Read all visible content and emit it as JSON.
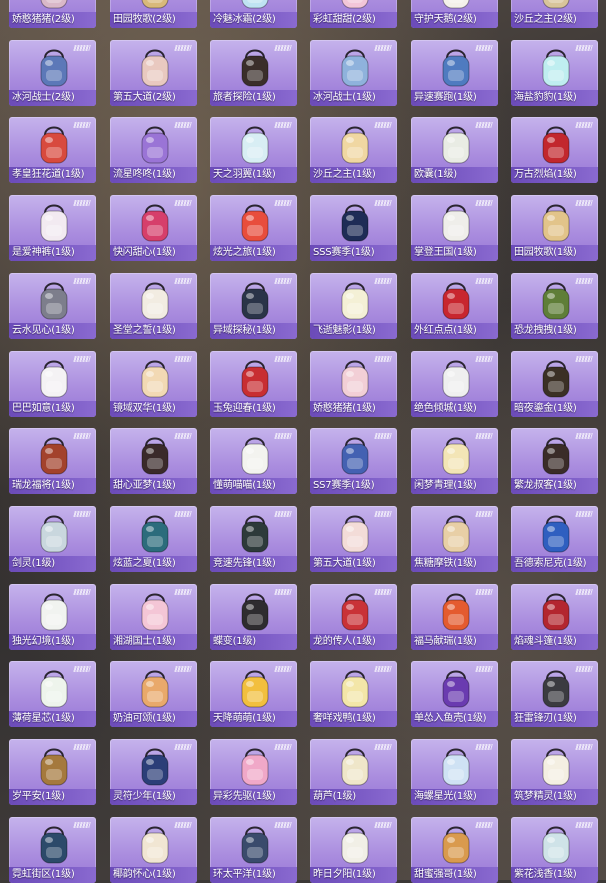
{
  "colors": {
    "card_top": "#c5b3ec",
    "card_bottom": "#9777d6",
    "label_bar": "#6b4bb8"
  },
  "items": [
    {
      "label": "娇憨猪猪(2级)",
      "icon": "pig-backpack-icon",
      "color": "#d9b8c8"
    },
    {
      "label": "田园牧歌(2级)",
      "icon": "basket-backpack-icon",
      "color": "#d8b97a"
    },
    {
      "label": "冷魅冰霜(2级)",
      "icon": "ice-backpack-icon",
      "color": "#bfe3f2"
    },
    {
      "label": "彩虹甜甜(2级)",
      "icon": "rainbow-backpack-icon",
      "color": "#f2c6d8"
    },
    {
      "label": "守护天鹅(2级)",
      "icon": "swan-backpack-icon",
      "color": "#f4f1ea"
    },
    {
      "label": "沙丘之主(2级)",
      "icon": "dune-backpack-icon",
      "color": "#d8c49a"
    },
    {
      "label": "冰河战士(2级)",
      "icon": "glacier-backpack-icon",
      "color": "#5c78b8"
    },
    {
      "label": "第五大道(2级)",
      "icon": "fifth-avenue-backpack-icon",
      "color": "#e9c9c0"
    },
    {
      "label": "旅者探险(1级)",
      "icon": "explorer-backpack-icon",
      "color": "#3a2e2a"
    },
    {
      "label": "冰河战士(1级)",
      "icon": "glacier-backpack-icon",
      "color": "#8fb2dc"
    },
    {
      "label": "异速赛跑(1级)",
      "icon": "racer-backpack-icon",
      "color": "#4f7bc0"
    },
    {
      "label": "海盐豹豹(1级)",
      "icon": "leopard-backpack-icon",
      "color": "#bfeef0"
    },
    {
      "label": "孝皇狂花道(1级)",
      "icon": "flower-backpack-icon",
      "color": "#d84a3e"
    },
    {
      "label": "流星咚咚(1级)",
      "icon": "meteor-backpack-icon",
      "color": "#9a74d6"
    },
    {
      "label": "天之羽翼(1级)",
      "icon": "wing-backpack-icon",
      "color": "#d8eef4"
    },
    {
      "label": "沙丘之主(1级)",
      "icon": "dune-backpack-icon",
      "color": "#f0d7a2"
    },
    {
      "label": "欧囊(1级)",
      "icon": "pouch-backpack-icon",
      "color": "#e9ece4"
    },
    {
      "label": "万古烈焰(1级)",
      "icon": "flame-backpack-icon",
      "color": "#c2272e"
    },
    {
      "label": "是爱神裤(1级)",
      "icon": "bunny-backpack-icon",
      "color": "#f2eaf1"
    },
    {
      "label": "快闪甜心(1级)",
      "icon": "camera-backpack-icon",
      "color": "#d63f6b"
    },
    {
      "label": "炫光之旅(1级)",
      "icon": "trip-backpack-icon",
      "color": "#e84d3c"
    },
    {
      "label": "SSS赛季(1级)",
      "icon": "season-backpack-icon",
      "color": "#1e2c56"
    },
    {
      "label": "掌登王国(1级)",
      "icon": "panda-backpack-icon",
      "color": "#efeeea"
    },
    {
      "label": "田园牧歌(1级)",
      "icon": "basket-backpack-icon",
      "color": "#e2c48a"
    },
    {
      "label": "云水见心(1级)",
      "icon": "cloud-backpack-icon",
      "color": "#7d7e8c"
    },
    {
      "label": "圣堂之誓(1级)",
      "icon": "heart-backpack-icon",
      "color": "#f2ece2"
    },
    {
      "label": "异域探秘(1级)",
      "icon": "mystery-backpack-icon",
      "color": "#2a3448"
    },
    {
      "label": "飞逝魅影(1级)",
      "icon": "phantom-backpack-icon",
      "color": "#f4f0d6"
    },
    {
      "label": "外红点点(1级)",
      "icon": "dot-backpack-icon",
      "color": "#c8262f"
    },
    {
      "label": "恐龙拽拽(1级)",
      "icon": "dino-backpack-icon",
      "color": "#5f7e38"
    },
    {
      "label": "巴巴如意(1级)",
      "icon": "rabbit-backpack-icon",
      "color": "#f4f2f4"
    },
    {
      "label": "镜域双华(1级)",
      "icon": "mirror-backpack-icon",
      "color": "#f2d9b4"
    },
    {
      "label": "玉兔迎春(1级)",
      "icon": "jade-rabbit-backpack-icon",
      "color": "#c82e32"
    },
    {
      "label": "娇憨猪猪(1级)",
      "icon": "pig-backpack-icon",
      "color": "#f2cfd6"
    },
    {
      "label": "绝色倾城(1级)",
      "icon": "beauty-backpack-icon",
      "color": "#efefef"
    },
    {
      "label": "暗夜鎏金(1级)",
      "icon": "gold-backpack-icon",
      "color": "#3b3025"
    },
    {
      "label": "瑞龙福将(1级)",
      "icon": "dragon-backpack-icon",
      "color": "#a3422c"
    },
    {
      "label": "甜心亚梦(1级)",
      "icon": "sweetheart-backpack-icon",
      "color": "#3a2a2a"
    },
    {
      "label": "懂萌喵喵(1级)",
      "icon": "kitty-backpack-icon",
      "color": "#f3f3ef"
    },
    {
      "label": "SS7赛季(1级)",
      "icon": "season-backpack-icon",
      "color": "#4461b2"
    },
    {
      "label": "闲梦青理(1级)",
      "icon": "dream-backpack-icon",
      "color": "#f3e5b6"
    },
    {
      "label": "繁龙叔客(1级)",
      "icon": "traveler-backpack-icon",
      "color": "#3a2c28"
    },
    {
      "label": "剑灵(1级)",
      "icon": "sword-backpack-icon",
      "color": "#c9d7de"
    },
    {
      "label": "炫蓝之夏(1级)",
      "icon": "summer-backpack-icon",
      "color": "#2c6c7c"
    },
    {
      "label": "竞速先锋(1级)",
      "icon": "speed-backpack-icon",
      "color": "#2d3a3a"
    },
    {
      "label": "第五大道(1级)",
      "icon": "fifth-avenue-backpack-icon",
      "color": "#f3dcd8"
    },
    {
      "label": "焦糖摩铁(1级)",
      "icon": "caramel-backpack-icon",
      "color": "#e8cfa6"
    },
    {
      "label": "吾德索尼克(1级)",
      "icon": "sonic-backpack-icon",
      "color": "#2f5fc0"
    },
    {
      "label": "独光幻境(1级)",
      "icon": "illusion-backpack-icon",
      "color": "#f1f3f0"
    },
    {
      "label": "湘湖国士(1级)",
      "icon": "guardian-backpack-icon",
      "color": "#f4c6d6"
    },
    {
      "label": "蝶变(1级)",
      "icon": "butterfly-backpack-icon",
      "color": "#2e2c2f"
    },
    {
      "label": "龙的传人(1级)",
      "icon": "dragon-heir-backpack-icon",
      "color": "#c93237"
    },
    {
      "label": "福马献瑞(1级)",
      "icon": "horse-backpack-icon",
      "color": "#e45b2f"
    },
    {
      "label": "焰魂斗篷(1级)",
      "icon": "cape-backpack-icon",
      "color": "#b3262f"
    },
    {
      "label": "薄荷星芯(1级)",
      "icon": "mint-backpack-icon",
      "color": "#eef4ec"
    },
    {
      "label": "奶油可颂(1级)",
      "icon": "croissant-backpack-icon",
      "color": "#e9a96b"
    },
    {
      "label": "天降萌萌(1级)",
      "icon": "cute-backpack-icon",
      "color": "#f2bf3e"
    },
    {
      "label": "奢咩戏鸭(1级)",
      "icon": "duck-backpack-icon",
      "color": "#f3e6a8"
    },
    {
      "label": "单怂入鱼壳(1级)",
      "icon": "shell-backpack-icon",
      "color": "#6a3bb0"
    },
    {
      "label": "狂雷锋刃(1级)",
      "icon": "blade-backpack-icon",
      "color": "#3b3b40"
    },
    {
      "label": "岁平安(1级)",
      "icon": "peace-basket-icon",
      "color": "#a5793d"
    },
    {
      "label": "灵符少年(1级)",
      "icon": "talisman-backpack-icon",
      "color": "#2b3e78"
    },
    {
      "label": "异彩先驱(1级)",
      "icon": "pioneer-backpack-icon",
      "color": "#f0a8c8"
    },
    {
      "label": "葫芦(1级)",
      "icon": "gourd-icon",
      "color": "#efe6c9"
    },
    {
      "label": "海螺星光(1级)",
      "icon": "conch-backpack-icon",
      "color": "#cfe2f4"
    },
    {
      "label": "筑梦精灵(1级)",
      "icon": "sprite-backpack-icon",
      "color": "#f4efe2"
    },
    {
      "label": "霓虹街区(1级)",
      "icon": "neon-backpack-icon",
      "color": "#2c4a6a"
    },
    {
      "label": "椰韵怀心(1级)",
      "icon": "coconut-backpack-icon",
      "color": "#f1e6d3"
    },
    {
      "label": "环太平洋(1级)",
      "icon": "pacific-backpack-icon",
      "color": "#3a4b6c"
    },
    {
      "label": "昨日夕阳(1级)",
      "icon": "sunset-backpack-icon",
      "color": "#f1efe6"
    },
    {
      "label": "甜蜜强哥(1级)",
      "icon": "cookie-backpack-icon",
      "color": "#d99a4e"
    },
    {
      "label": "紫花浅香(1级)",
      "icon": "violet-backpack-icon",
      "color": "#cfe3e8"
    }
  ]
}
